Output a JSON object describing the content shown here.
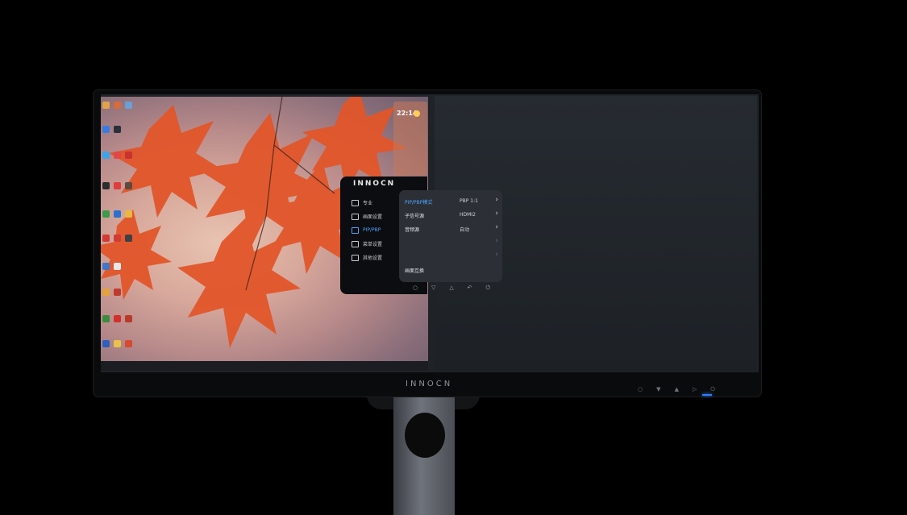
{
  "brand": {
    "osd_logo": "INNOCN",
    "bezel_logo": "INNOCN"
  },
  "desktop_widget": {
    "title": "",
    "time": "22:14"
  },
  "osd": {
    "nav_items": [
      {
        "label": "专业",
        "icon": "monitor-icon"
      },
      {
        "label": "画面设置",
        "icon": "picture-frame-icon"
      },
      {
        "label": "PIP/PBP",
        "icon": "pip-icon",
        "active": true
      },
      {
        "label": "菜单设置",
        "icon": "menu-list-icon"
      },
      {
        "label": "其他设置",
        "icon": "settings-grid-icon"
      }
    ],
    "sub_items": [
      {
        "label": "PIP/PBP模式",
        "value": "PBP 1:1",
        "arrow": "›",
        "active": true
      },
      {
        "label": "子信号源",
        "value": "HDMI2",
        "arrow": "›"
      },
      {
        "label": "音频源",
        "value": "自动",
        "arrow": "›"
      },
      {
        "label": "",
        "value": "",
        "arrow": "›",
        "dim": true
      },
      {
        "label": "",
        "value": "",
        "arrow": "›",
        "dim": true
      },
      {
        "label": "画面互换",
        "value": "",
        "arrow": ""
      }
    ],
    "key_glyphs": [
      "○",
      "▽",
      "△",
      "↶",
      "⏻"
    ]
  },
  "bezel": {
    "key_glyphs": [
      "○",
      "▼",
      "▲",
      "▷",
      "⏻"
    ]
  },
  "colors": {
    "accent": "#4da3ff",
    "led": "#2e7dff",
    "leaf": "#e2562a"
  }
}
